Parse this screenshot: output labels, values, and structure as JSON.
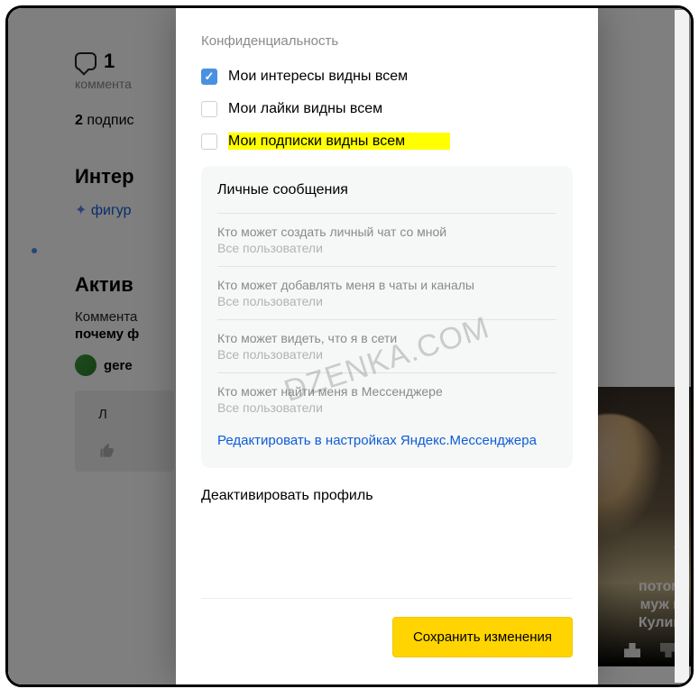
{
  "bg": {
    "stat_num": "1",
    "stat_label": "коммента",
    "subs_num": "2",
    "subs_word": "подпис",
    "interests_h": "Интер",
    "interests_link": "фигур",
    "activity_h": "Актив",
    "activity_sub": "Коммента",
    "activity_bold": "почему ф",
    "username": "gere",
    "graybox_text": "Л"
  },
  "right": {
    "caption": "у\nе\nпотом\nмуж и\nКулин"
  },
  "modal": {
    "privacy_heading": "Конфиденциальность",
    "checks": [
      {
        "label": "Мои интересы видны всем",
        "checked": true
      },
      {
        "label": "Мои лайки видны всем",
        "checked": false
      },
      {
        "label": "Мои подписки видны всем",
        "checked": false,
        "highlight": true
      }
    ],
    "card_heading": "Личные сообщения",
    "options": [
      {
        "q": "Кто может создать личный чат со мной",
        "v": "Все пользователи"
      },
      {
        "q": "Кто может добавлять меня в чаты и каналы",
        "v": "Все пользователи"
      },
      {
        "q": "Кто может видеть, что я в сети",
        "v": "Все пользователи"
      },
      {
        "q": "Кто может найти меня в Мессенджере",
        "v": "Все пользователи"
      }
    ],
    "edit_link": "Редактировать в настройках Яндекс.Мессенджера",
    "deactivate": "Деактивировать профиль",
    "save_button": "Сохранить изменения"
  },
  "watermark": "DZENKA.COM"
}
